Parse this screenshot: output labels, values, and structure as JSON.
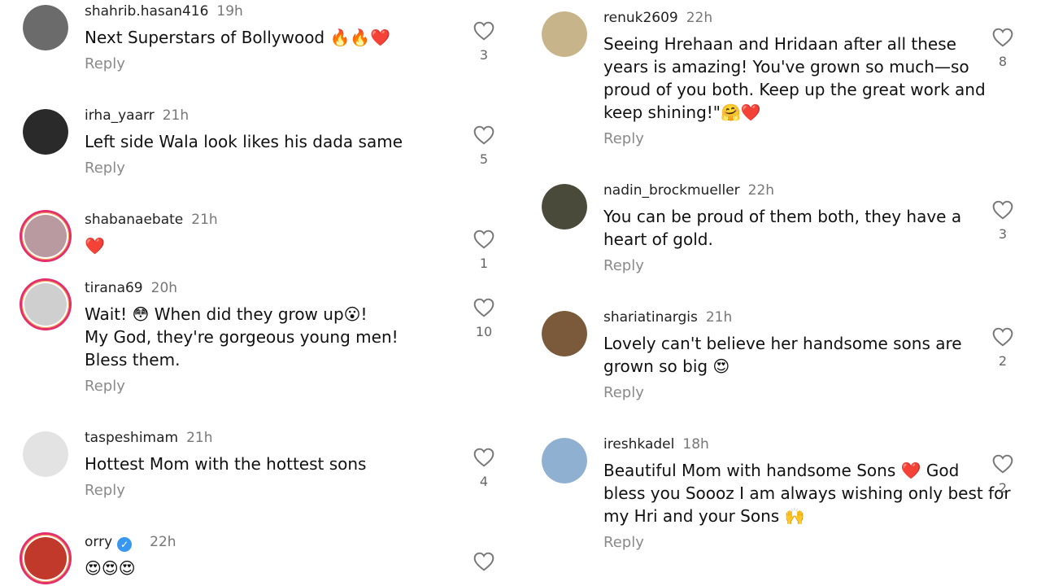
{
  "left_comments": [
    {
      "username": "shahrib.hasan416",
      "time": "19h",
      "lines": [
        "Next Superstars of Bollywood 🔥🔥❤️"
      ],
      "reply_label": "Reply",
      "likes": "3",
      "avatar_color": "#6b6b6b"
    },
    {
      "username": "irha_yaarr",
      "time": "21h",
      "lines": [
        "Left side Wala look likes his dada same"
      ],
      "reply_label": "Reply",
      "likes": "5",
      "avatar_color": "#2a2a2a"
    },
    {
      "username": "shabanaebate",
      "time": "21h",
      "lines": [
        "❤️"
      ],
      "reply_label": "",
      "likes": "1",
      "avatar_color": "#b89aa0"
    },
    {
      "username": "tirana69",
      "time": "20h",
      "lines": [
        "Wait! 😳 When did they grow up😮!",
        "My God, they're gorgeous young men!",
        "Bless them."
      ],
      "reply_label": "Reply",
      "likes": "10",
      "avatar_color": "#cfcfcf"
    },
    {
      "username": "taspeshimam",
      "time": "21h",
      "lines": [
        "Hottest Mom with the hottest sons"
      ],
      "reply_label": "Reply",
      "likes": "4",
      "avatar_color": "#e3e3e3"
    },
    {
      "username": "orry",
      "time": "22h",
      "lines": [
        "😍😍😍"
      ],
      "reply_label": "",
      "likes": "",
      "avatar_color": "#c0392b"
    }
  ],
  "right_comments": [
    {
      "username": "renuk2609",
      "time": "22h",
      "lines": [
        "Seeing Hrehaan and Hridaan after all these",
        "years is amazing! You've grown so much—so",
        "proud of you both. Keep up the great work and",
        "keep shining!\"🤗❤️"
      ],
      "reply_label": "Reply",
      "likes": "8",
      "avatar_color": "#c8b48a"
    },
    {
      "username": "nadin_brockmueller",
      "time": "22h",
      "lines": [
        "You can be proud of them both, they have a",
        "heart of gold."
      ],
      "reply_label": "Reply",
      "likes": "3",
      "avatar_color": "#4a4a3a"
    },
    {
      "username": "shariatinargis",
      "time": "21h",
      "lines": [
        "Lovely can't believe her handsome sons are",
        "grown so big 😍"
      ],
      "reply_label": "Reply",
      "likes": "2",
      "avatar_color": "#7a5a3a"
    },
    {
      "username": "ireshkadel",
      "time": "18h",
      "lines": [
        "Beautiful Mom with handsome Sons ❤️ God",
        "bless you Soooz I am always wishing only best for",
        "my Hri  and your Sons 🙌"
      ],
      "reply_label": "Reply",
      "likes": "2",
      "avatar_color": "#8fb0d0"
    }
  ],
  "icons": {
    "like": "heart-outline-icon",
    "verified": "verified-badge-icon"
  },
  "colors": {
    "accent_ring": "#e1306c",
    "verified": "#3897f0",
    "muted": "#8a8a8a"
  }
}
